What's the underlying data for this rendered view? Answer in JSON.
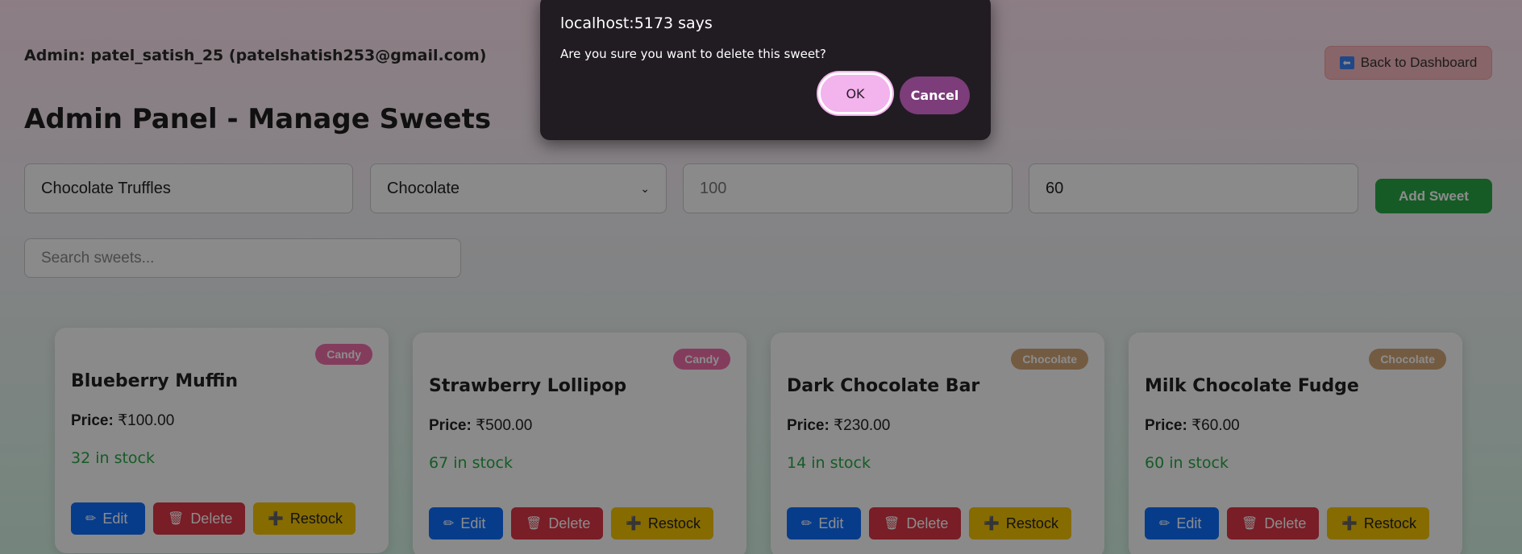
{
  "header": {
    "admin_label": "Admin:",
    "admin_value": "patel_satish_25 (patelshatish253@gmail.com)",
    "back_button": "Back to Dashboard",
    "title": "Admin Panel - Manage Sweets"
  },
  "form": {
    "name_value": "Chocolate Truffles",
    "category_value": "Chocolate",
    "price_value": "100",
    "quantity_value": "60",
    "add_button": "Add Sweet"
  },
  "search": {
    "placeholder": "Search sweets..."
  },
  "colors": {
    "candy_badge": "#f06eaa",
    "chocolate_badge": "#d2a679",
    "edit": "#0d6efd",
    "delete": "#dc3545",
    "restock": "#f5c400",
    "stock_text": "#28a745"
  },
  "cards": [
    {
      "badge": "Candy",
      "name": "Blueberry Muffin",
      "price_label": "Price:",
      "price": "₹100.00",
      "stock": "32 in stock",
      "edit": "Edit",
      "delete": "Delete",
      "restock": "Restock"
    },
    {
      "badge": "Candy",
      "name": "Strawberry Lollipop",
      "price_label": "Price:",
      "price": "₹500.00",
      "stock": "67 in stock",
      "edit": "Edit",
      "delete": "Delete",
      "restock": "Restock"
    },
    {
      "badge": "Chocolate",
      "name": "Dark Chocolate Bar",
      "price_label": "Price:",
      "price": "₹230.00",
      "stock": "14 in stock",
      "edit": "Edit",
      "delete": "Delete",
      "restock": "Restock"
    },
    {
      "badge": "Chocolate",
      "name": "Milk Chocolate Fudge",
      "price_label": "Price:",
      "price": "₹60.00",
      "stock": "60 in stock",
      "edit": "Edit",
      "delete": "Delete",
      "restock": "Restock"
    }
  ],
  "dialog": {
    "title": "localhost:5173 says",
    "message": "Are you sure you want to delete this sweet?",
    "ok": "OK",
    "cancel": "Cancel"
  },
  "icons": {
    "back": "left-arrow-icon",
    "edit": "pencil-icon",
    "delete": "trash-icon",
    "restock": "plus-icon",
    "select": "chevron-down-icon"
  }
}
